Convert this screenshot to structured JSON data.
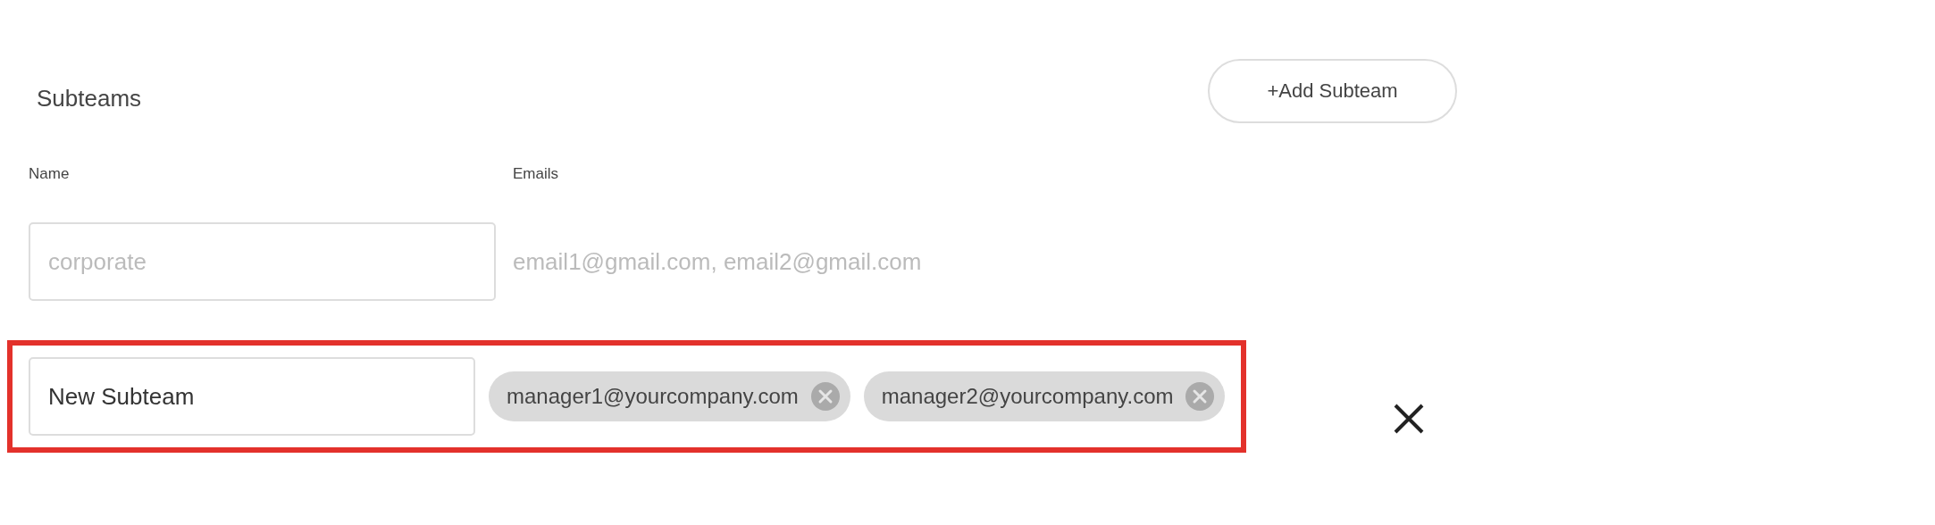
{
  "section": {
    "title": "Subteams",
    "add_button": "+Add Subteam"
  },
  "columns": [
    "Name",
    "Emails"
  ],
  "rows": [
    {
      "kind": "template",
      "name_placeholder": "corporate",
      "emails_placeholder": "email1@gmail.com, email2@gmail.com",
      "highlighted": false
    },
    {
      "kind": "entry",
      "name": "New Subteam",
      "emails": [
        "manager1@yourcompany.com",
        "manager2@yourcompany.com"
      ],
      "highlighted": true,
      "removable": true
    }
  ]
}
